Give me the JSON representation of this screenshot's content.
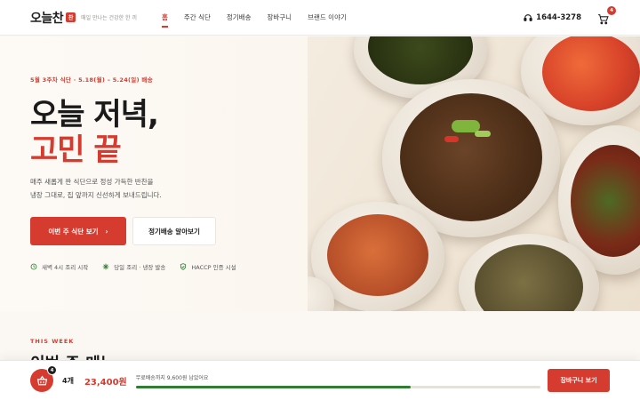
{
  "header": {
    "logo_text": "오늘찬",
    "logo_badge": "찬",
    "tagline": "매일 만나는 건강한 한 끼",
    "nav": [
      {
        "label": "홈",
        "active": true
      },
      {
        "label": "주간 식단",
        "active": false
      },
      {
        "label": "정기배송",
        "active": false
      },
      {
        "label": "장바구니",
        "active": false
      },
      {
        "label": "브랜드 이야기",
        "active": false
      }
    ],
    "phone": "1644-3278",
    "phone_icon": "headset-icon",
    "cart_icon": "cart-icon",
    "cart_count": "4"
  },
  "hero": {
    "eyebrow": "5월 3주차 식단 · 5.18(월) – 5.24(일) 배송",
    "title_line1": "오늘 저녁,",
    "title_line2": "고민 끝",
    "desc_line1": "매주 새롭게 짠 식단으로 정성 가득한 반찬을",
    "desc_line2": "냉장 그대로, 집 앞까지 신선하게 보내드립니다.",
    "primary_button": "이번 주 식단 보기",
    "secondary_button": "정기배송 알아보기",
    "features": [
      {
        "icon": "clock-icon",
        "label": "새벽 4시 조리 시작"
      },
      {
        "icon": "snowflake-icon",
        "label": "당일 조리 · 냉장 발송"
      },
      {
        "icon": "shield-icon",
        "label": "HACCP 인증 시설"
      }
    ]
  },
  "section": {
    "tag": "THIS WEEK",
    "title": "이번 주 메뉴"
  },
  "bottom_bar": {
    "cart_count": "4",
    "quantity": "4개",
    "total": "23,400원",
    "shipping_message": "무료배송까지 9,600원 남았어요",
    "progress": 0.68,
    "button": "장바구니 보기"
  },
  "colors": {
    "accent": "#d63b2f",
    "progress": "#2e7d32",
    "background": "#fbf8f4"
  }
}
